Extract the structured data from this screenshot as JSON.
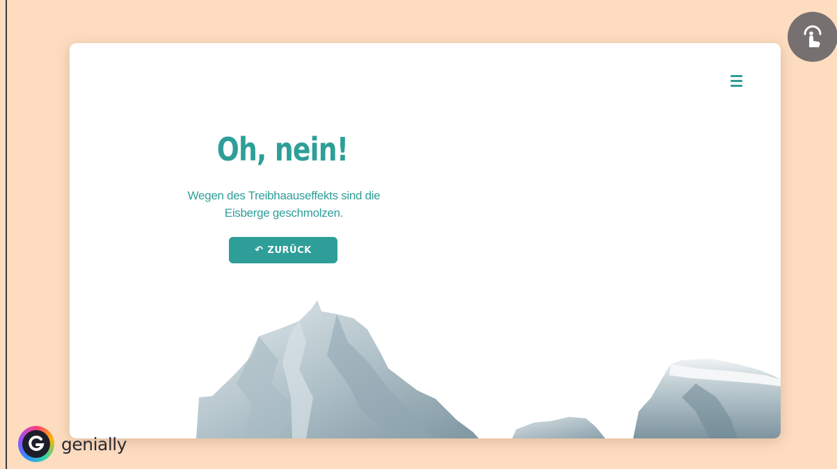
{
  "page": {
    "background": "#fddcc0",
    "accent": "#2e9e98"
  },
  "card": {
    "title": "Oh, nein!",
    "subtitle_line1": "Wegen des Treibhaauseffekts sind die",
    "subtitle_line2": "Eisberge geschmolzen.",
    "back_button": {
      "icon": "undo-icon",
      "label": "ZURÜCK"
    },
    "menu_icon": "hamburger-menu-icon",
    "illustration": "icebergs"
  },
  "touch_button": {
    "icon": "tap-hand-icon",
    "color": "#777070"
  },
  "branding": {
    "name": "genially"
  }
}
